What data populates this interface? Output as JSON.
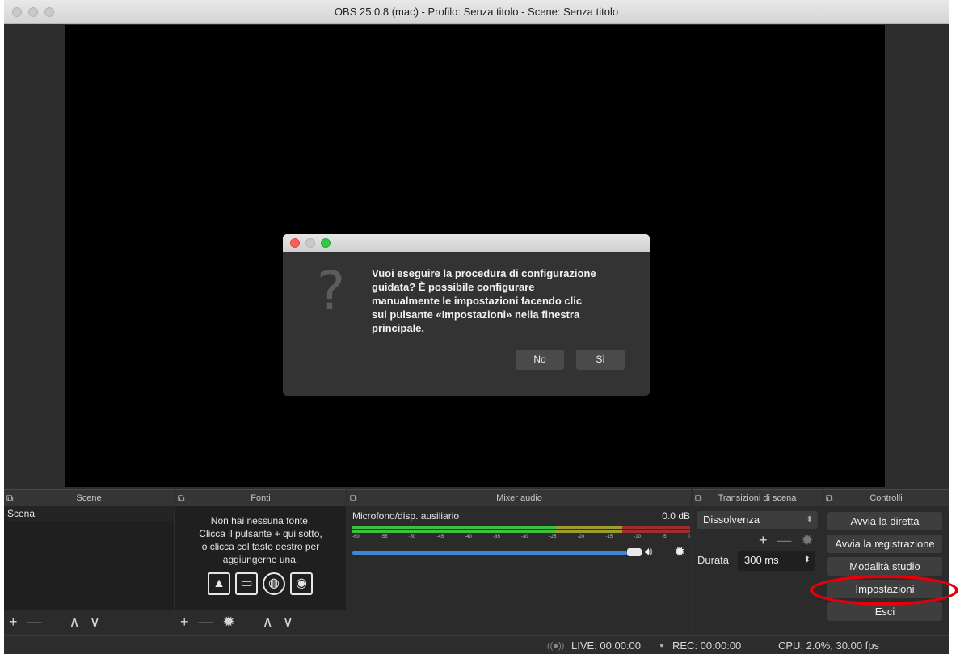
{
  "window": {
    "title": "OBS 25.0.8 (mac) - Profilo: Senza titolo - Scene: Senza titolo"
  },
  "dialog": {
    "icon": "question-mark-icon",
    "message": "Vuoi eseguire la procedura di configurazione\nguidata? È possibile configurare\nmanualmente le impostazioni facendo clic\nsul pulsante «Impostazioni» nella finestra\nprincipale.",
    "buttons": {
      "no": "No",
      "yes": "Sì"
    }
  },
  "docks": {
    "scene": {
      "title": "Scene",
      "items": [
        "Scena"
      ]
    },
    "fonti": {
      "title": "Fonti",
      "empty_text": "Non hai nessuna fonte.\nClicca il pulsante + qui sotto,\no clicca col tasto destro per\naggiungerne una."
    },
    "mixer": {
      "title": "Mixer audio",
      "track_name": "Microfono/disp. ausiliario",
      "db_value": "0.0 dB",
      "ticks": [
        "-60",
        "-55",
        "-50",
        "-45",
        "-40",
        "-35",
        "-30",
        "-25",
        "-20",
        "-15",
        "-10",
        "-5",
        "0"
      ],
      "volume": 0.92
    },
    "transizioni": {
      "title": "Transizioni di scena",
      "selected": "Dissolvenza",
      "duration_label": "Durata",
      "duration_value": "300 ms"
    },
    "controlli": {
      "title": "Controlli",
      "buttons": {
        "start_stream": "Avvia la diretta",
        "start_recording": "Avvia la registrazione",
        "studio_mode": "Modalità studio",
        "settings": "Impostazioni",
        "exit": "Esci"
      }
    }
  },
  "statusbar": {
    "live": "LIVE: 00:00:00",
    "rec": "REC: 00:00:00",
    "cpu": "CPU: 2.0%, 30.00 fps"
  },
  "colors": {
    "highlight": "#e3000b",
    "volume_bar": "#3d88d6",
    "meter_green": "#3fbf3f"
  }
}
